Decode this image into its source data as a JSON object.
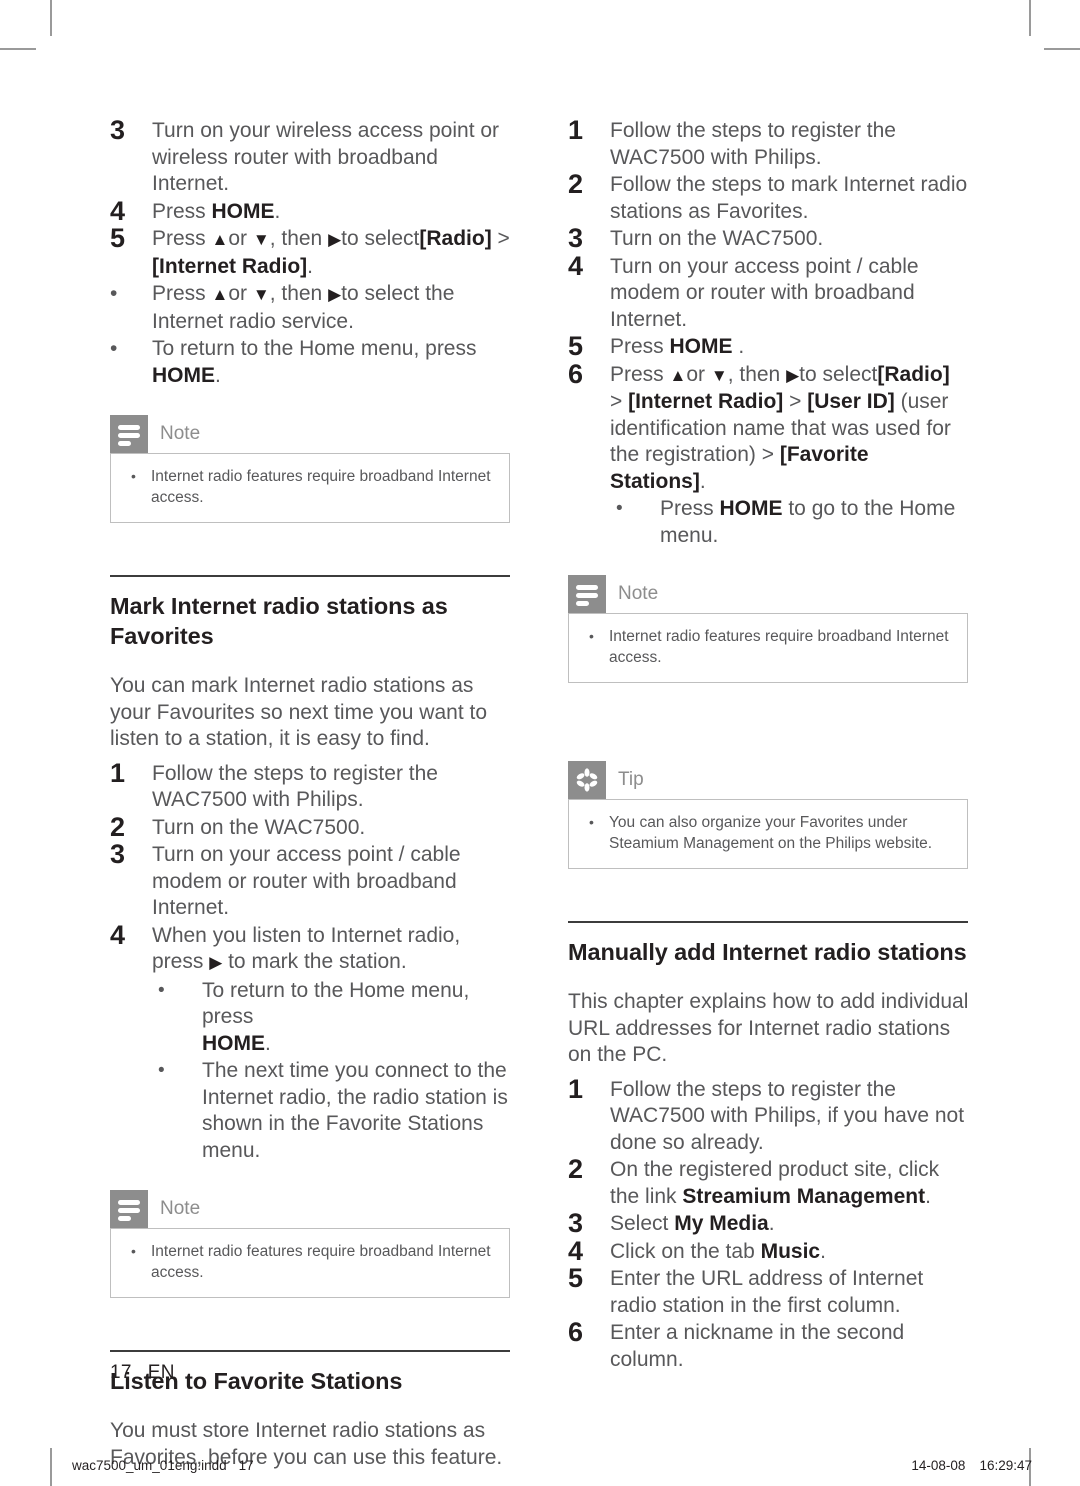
{
  "document": {
    "page_number": "17",
    "language_code": "EN",
    "footer_file": "wac7500_um_01eng.indd",
    "footer_page": "17",
    "footer_date": "14-08-08",
    "footer_time": "16:29:47"
  },
  "colors": {
    "heading": "#231f20",
    "body": "#58585a",
    "callout_icon_bg": "#8d8d8d",
    "callout_border": "#bfbfbf",
    "rule": "#3c3c3c"
  },
  "left_column": {
    "top_steps": [
      {
        "marker": "3",
        "type": "number",
        "text": "Turn on your wireless access point or wireless router with broadband Internet."
      },
      {
        "marker": "4",
        "type": "number",
        "text": "Press HOME.",
        "bold_part": "HOME"
      },
      {
        "marker": "5",
        "type": "number",
        "text": "Press ▲or ▼, then ▶to select[Radio] > [Internet Radio]."
      },
      {
        "marker": "•",
        "type": "bullet",
        "text": "Press ▲or ▼, then ▶to select the Internet radio service."
      },
      {
        "marker": "•",
        "type": "bullet",
        "text": "To return to the Home menu, press HOME."
      }
    ],
    "note1": {
      "label": "Note",
      "icon": "note-lines-icon",
      "items": [
        "Internet radio features require broadband Internet access."
      ]
    },
    "section2": {
      "title": "Mark Internet radio stations as Favorites",
      "intro": "You can mark Internet radio stations as your Favourites so next time you want to listen to a station, it is easy to find.",
      "steps": [
        {
          "marker": "1",
          "type": "number",
          "text": "Follow the steps to register the WAC7500 with Philips."
        },
        {
          "marker": "2",
          "type": "number",
          "text": "Turn on the WAC7500."
        },
        {
          "marker": "3",
          "type": "number",
          "text": "Turn on your access point / cable modem or router with broadband Internet."
        },
        {
          "marker": "4",
          "type": "number",
          "text": "When you listen to Internet radio, press ▶ to mark the station."
        },
        {
          "marker": "•",
          "type": "sub-bullet",
          "text": "To return to the Home menu, press HOME."
        },
        {
          "marker": "•",
          "type": "sub-bullet",
          "text": "The next time you connect to the Internet radio, the radio station is shown in the Favorite Stations menu."
        }
      ]
    },
    "note2": {
      "label": "Note",
      "icon": "note-lines-icon",
      "items": [
        "Internet radio features require broadband Internet access."
      ]
    },
    "section3": {
      "title": "Listen to Favorite Stations",
      "intro": "You must store Internet radio stations as Favorites, before you can use this feature."
    }
  },
  "right_column": {
    "top_steps": [
      {
        "marker": "1",
        "type": "number",
        "text": "Follow the steps to register the WAC7500 with Philips."
      },
      {
        "marker": "2",
        "type": "number",
        "text": "Follow the steps to mark Internet radio stations as Favorites."
      },
      {
        "marker": "3",
        "type": "number",
        "text": "Turn on the WAC7500."
      },
      {
        "marker": "4",
        "type": "number",
        "text": "Turn on your access point / cable modem or router with broadband Internet."
      },
      {
        "marker": "5",
        "type": "number",
        "text": "Press HOME ."
      },
      {
        "marker": "6",
        "type": "number",
        "text": "Press ▲or ▼, then ▶to select[Radio] > [Internet Radio] > [User ID] (user identification name that was used for the registration) > [Favorite Stations]."
      },
      {
        "marker": "•",
        "type": "sub-bullet",
        "text": "Press HOME to go to the Home menu."
      }
    ],
    "note": {
      "label": "Note",
      "icon": "note-lines-icon",
      "items": [
        "Internet radio features require broadband Internet access."
      ]
    },
    "tip": {
      "label": "Tip",
      "icon": "asterisk-icon",
      "items": [
        "You can also organize your Favorites under Steamium Management on the Philips website."
      ]
    },
    "section": {
      "title": "Manually add Internet radio stations",
      "intro": "This chapter explains how to add individual URL addresses for Internet radio stations on the PC.",
      "steps": [
        {
          "marker": "1",
          "type": "number",
          "text": "Follow the steps to register the WAC7500 with Philips, if you have not done so already."
        },
        {
          "marker": "2",
          "type": "number",
          "text": "On the registered product site, click the link Streamium Management."
        },
        {
          "marker": "3",
          "type": "number",
          "text": "Select My Media."
        },
        {
          "marker": "4",
          "type": "number",
          "text": "Click on the tab Music."
        },
        {
          "marker": "5",
          "type": "number",
          "text": "Enter the URL address of Internet radio station in the first column."
        },
        {
          "marker": "6",
          "type": "number",
          "text": "Enter a nickname in the second column."
        }
      ]
    }
  }
}
